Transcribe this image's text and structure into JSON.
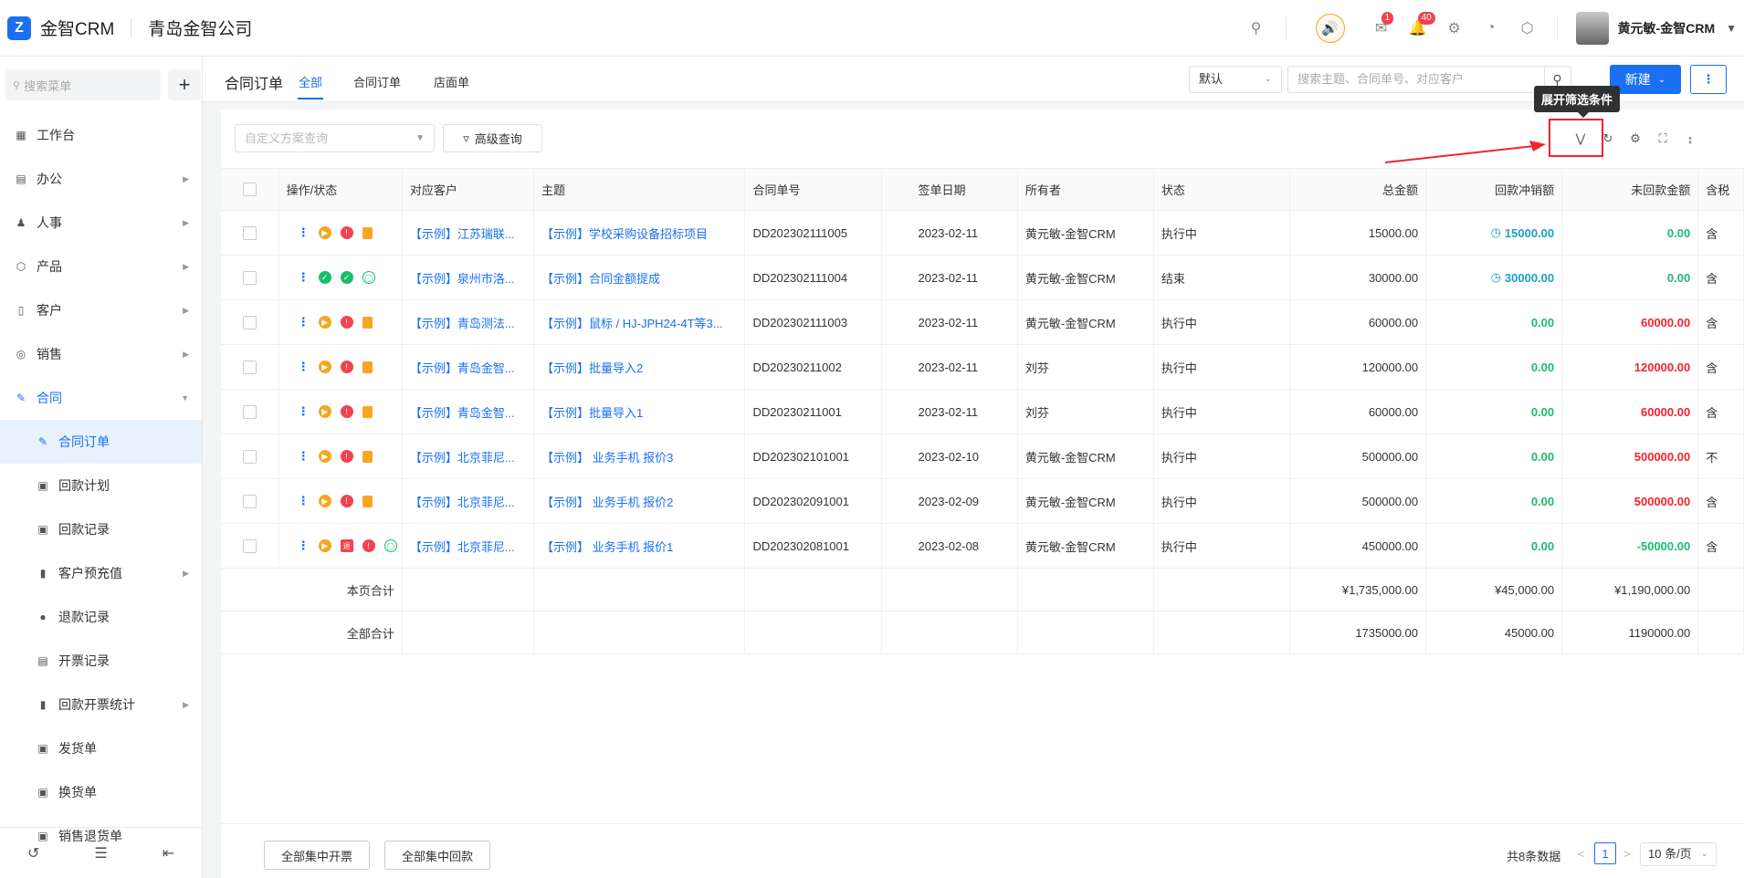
{
  "topbar": {
    "brand": "金智CRM",
    "company": "青岛金智公司",
    "mail_badge": "1",
    "bell_badge": "40",
    "username": "黄元敏-金智CRM"
  },
  "sidebar": {
    "search_placeholder": "搜索菜单",
    "items": [
      {
        "label": "工作台",
        "icon": "dashboard-icon"
      },
      {
        "label": "办公",
        "icon": "office-icon"
      },
      {
        "label": "人事",
        "icon": "people-icon"
      },
      {
        "label": "产品",
        "icon": "product-icon"
      },
      {
        "label": "客户",
        "icon": "customer-icon"
      },
      {
        "label": "销售",
        "icon": "sales-icon"
      },
      {
        "label": "合同",
        "icon": "contract-icon"
      },
      {
        "label": "合同订单",
        "icon": "contract-order-icon"
      },
      {
        "label": "回款计划",
        "icon": "payment-plan-icon"
      },
      {
        "label": "回款记录",
        "icon": "payment-record-icon"
      },
      {
        "label": "客户预充值",
        "icon": "folder-icon"
      },
      {
        "label": "退款记录",
        "icon": "refund-icon"
      },
      {
        "label": "开票记录",
        "icon": "invoice-icon"
      },
      {
        "label": "回款开票统计",
        "icon": "folder-icon"
      },
      {
        "label": "发货单",
        "icon": "shipping-icon"
      },
      {
        "label": "换货单",
        "icon": "exchange-icon"
      },
      {
        "label": "销售退货单",
        "icon": "return-icon"
      }
    ]
  },
  "header": {
    "title": "合同订单",
    "tabs": [
      "全部",
      "合同订单",
      "店面单"
    ],
    "default_select": "默认",
    "search_placeholder": "搜索主题、合同单号、对应客户",
    "new_label": "新建"
  },
  "filters": {
    "scheme_placeholder": "自定义方案查询",
    "advanced_label": "高级查询",
    "tooltip": "展开筛选条件"
  },
  "table": {
    "headers": [
      "操作/状态",
      "对应客户",
      "主题",
      "合同单号",
      "签单日期",
      "所有者",
      "状态",
      "总金额",
      "回款冲销额",
      "未回款金额",
      "含税"
    ],
    "rows": [
      {
        "customer": "【示例】江苏瑞联...",
        "subject": "【示例】学校采购设备招标项目",
        "no": "DD202302111005",
        "date": "2023-02-11",
        "owner": "黄元敏-金智CRM",
        "status": "执行中",
        "total": "15000.00",
        "paid": "15000.00",
        "unpaid": "0.00",
        "tax": "含"
      },
      {
        "customer": "【示例】泉州市洛...",
        "subject": "【示例】合同金额提成",
        "no": "DD202302111004",
        "date": "2023-02-11",
        "owner": "黄元敏-金智CRM",
        "status": "结束",
        "total": "30000.00",
        "paid": "30000.00",
        "unpaid": "0.00",
        "tax": "含"
      },
      {
        "customer": "【示例】青岛测法...",
        "subject": "【示例】鼠标 / HJ-JPH24-4T等3...",
        "no": "DD202302111003",
        "date": "2023-02-11",
        "owner": "黄元敏-金智CRM",
        "status": "执行中",
        "total": "60000.00",
        "paid": "0.00",
        "unpaid": "60000.00",
        "tax": "含"
      },
      {
        "customer": "【示例】青岛金智...",
        "subject": "【示例】批量导入2",
        "no": "DD20230211002",
        "date": "2023-02-11",
        "owner": "刘芬",
        "status": "执行中",
        "total": "120000.00",
        "paid": "0.00",
        "unpaid": "120000.00",
        "tax": "含"
      },
      {
        "customer": "【示例】青岛金智...",
        "subject": "【示例】批量导入1",
        "no": "DD20230211001",
        "date": "2023-02-11",
        "owner": "刘芬",
        "status": "执行中",
        "total": "60000.00",
        "paid": "0.00",
        "unpaid": "60000.00",
        "tax": "含"
      },
      {
        "customer": "【示例】北京菲尼...",
        "subject": "【示例】 业务手机 报价3",
        "no": "DD202302101001",
        "date": "2023-02-10",
        "owner": "黄元敏-金智CRM",
        "status": "执行中",
        "total": "500000.00",
        "paid": "0.00",
        "unpaid": "500000.00",
        "tax": "不"
      },
      {
        "customer": "【示例】北京菲尼...",
        "subject": "【示例】 业务手机 报价2",
        "no": "DD202302091001",
        "date": "2023-02-09",
        "owner": "黄元敏-金智CRM",
        "status": "执行中",
        "total": "500000.00",
        "paid": "0.00",
        "unpaid": "500000.00",
        "tax": "含"
      },
      {
        "customer": "【示例】北京菲尼...",
        "subject": "【示例】 业务手机 报价1",
        "no": "DD202302081001",
        "date": "2023-02-08",
        "owner": "黄元敏-金智CRM",
        "status": "执行中",
        "total": "450000.00",
        "paid": "0.00",
        "unpaid": "-50000.00",
        "tax": "含"
      }
    ],
    "page_sum_label": "本页合计",
    "page_sum": {
      "total": "¥1,735,000.00",
      "paid": "¥45,000.00",
      "unpaid": "¥1,190,000.00"
    },
    "all_sum_label": "全部合计",
    "all_sum": {
      "total": "1735000.00",
      "paid": "45000.00",
      "unpaid": "1190000.00"
    }
  },
  "footer": {
    "btn_invoice": "全部集中开票",
    "btn_payment": "全部集中回款",
    "total_text": "共8条数据",
    "page": "1",
    "page_size": "10 条/页"
  }
}
